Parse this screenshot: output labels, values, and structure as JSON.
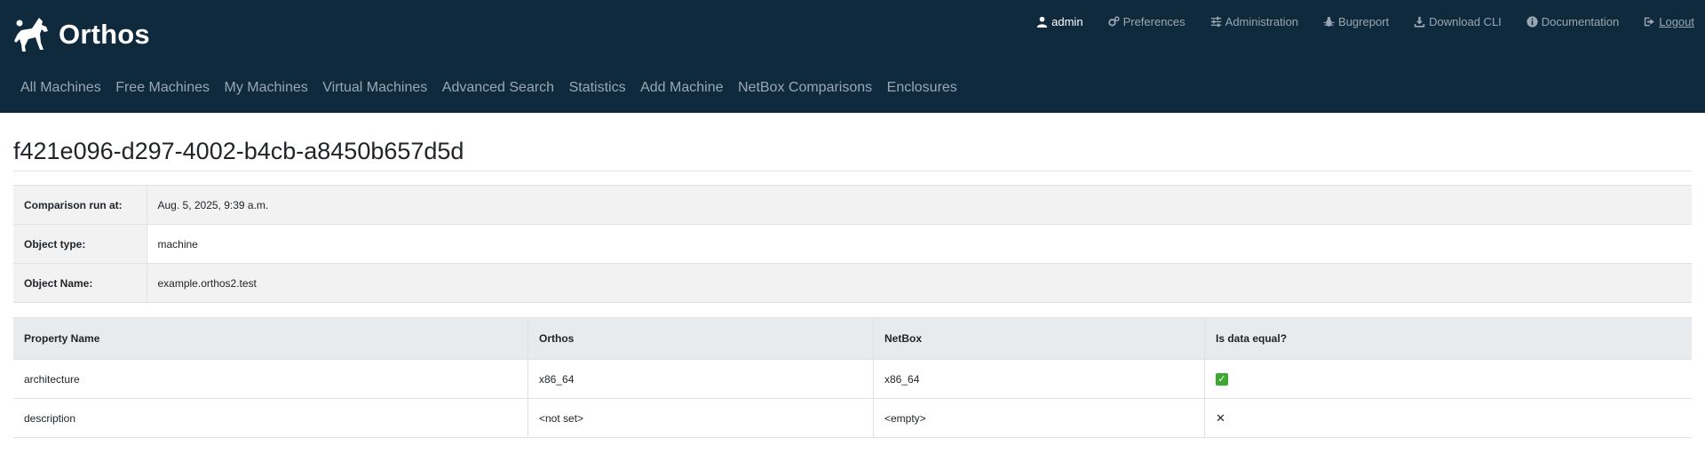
{
  "brand": {
    "name": "Orthos"
  },
  "top_nav": {
    "user": "admin",
    "links": [
      "Preferences",
      "Administration",
      "Bugreport",
      "Download CLI",
      "Documentation",
      "Logout"
    ]
  },
  "main_nav": [
    "All Machines",
    "Free Machines",
    "My Machines",
    "Virtual Machines",
    "Advanced Search",
    "Statistics",
    "Add Machine",
    "NetBox Comparisons",
    "Enclosures"
  ],
  "page_title": "f421e096-d297-4002-b4cb-a8450b657d5d",
  "info": {
    "run_at_label": "Comparison run at:",
    "run_at_value": "Aug. 5, 2025, 9:39 a.m.",
    "type_label": "Object type:",
    "type_value": "machine",
    "name_label": "Object Name:",
    "name_value": "example.orthos2.test"
  },
  "comparison": {
    "headers": [
      "Property Name",
      "Orthos",
      "NetBox",
      "Is data equal?"
    ],
    "rows": [
      {
        "property": "architecture",
        "orthos": "x86_64",
        "netbox": "x86_64",
        "equal_icon": "✓"
      },
      {
        "property": "description",
        "orthos": "<not set>",
        "netbox": "<empty>",
        "equal_icon": "✕"
      }
    ]
  },
  "colors": {
    "navbar": "#0f2a3d",
    "nav_text": "#9aa7b2",
    "equal_true": "#3ea832"
  }
}
